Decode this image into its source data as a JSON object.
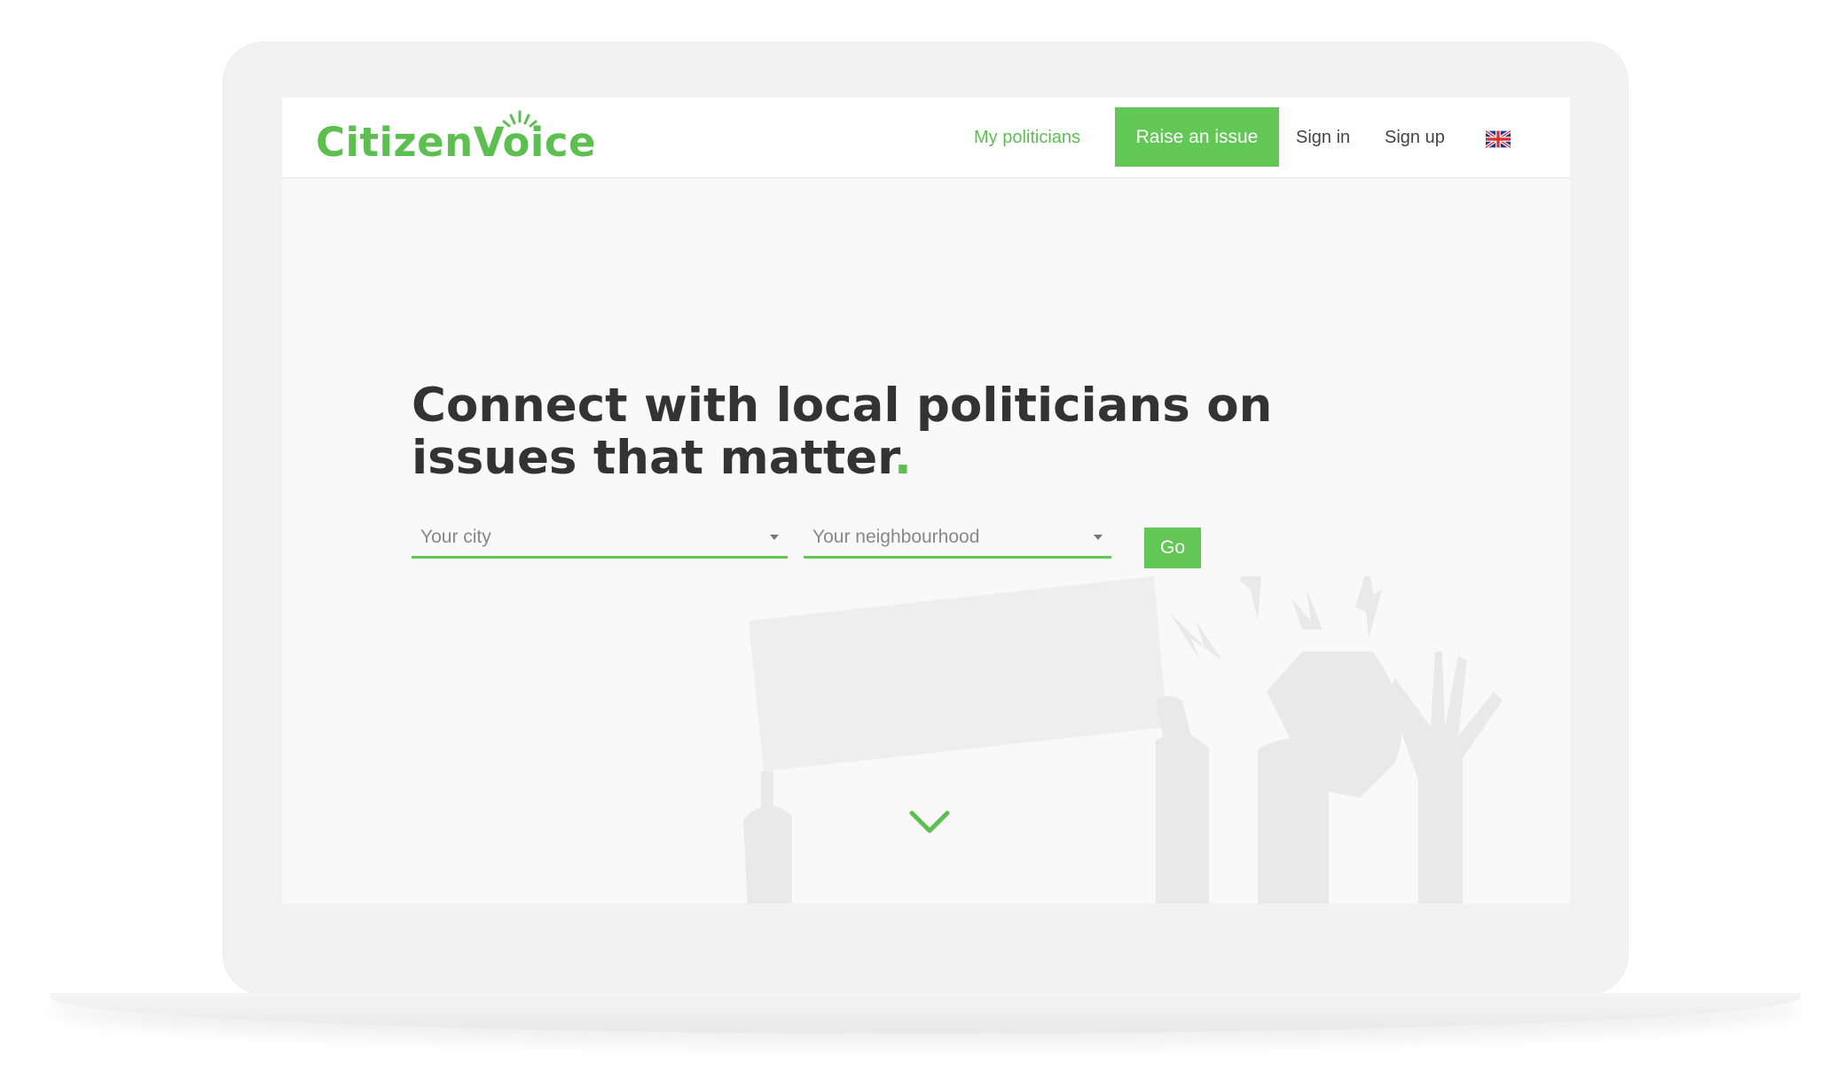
{
  "brand": {
    "logo_text": "CitizenVoice",
    "accent_color": "#63c756"
  },
  "nav": {
    "my_politicians": "My politicians",
    "raise_issue": "Raise an issue",
    "sign_in": "Sign in",
    "sign_up": "Sign up",
    "language_icon": "uk-flag-icon"
  },
  "hero": {
    "headline": "Connect with local politicians on issues that matter",
    "headline_dot": ".",
    "city_placeholder": "Your city",
    "neighbourhood_placeholder": "Your neighbourhood",
    "go_label": "Go",
    "scroll_icon": "chevron-down-icon"
  }
}
